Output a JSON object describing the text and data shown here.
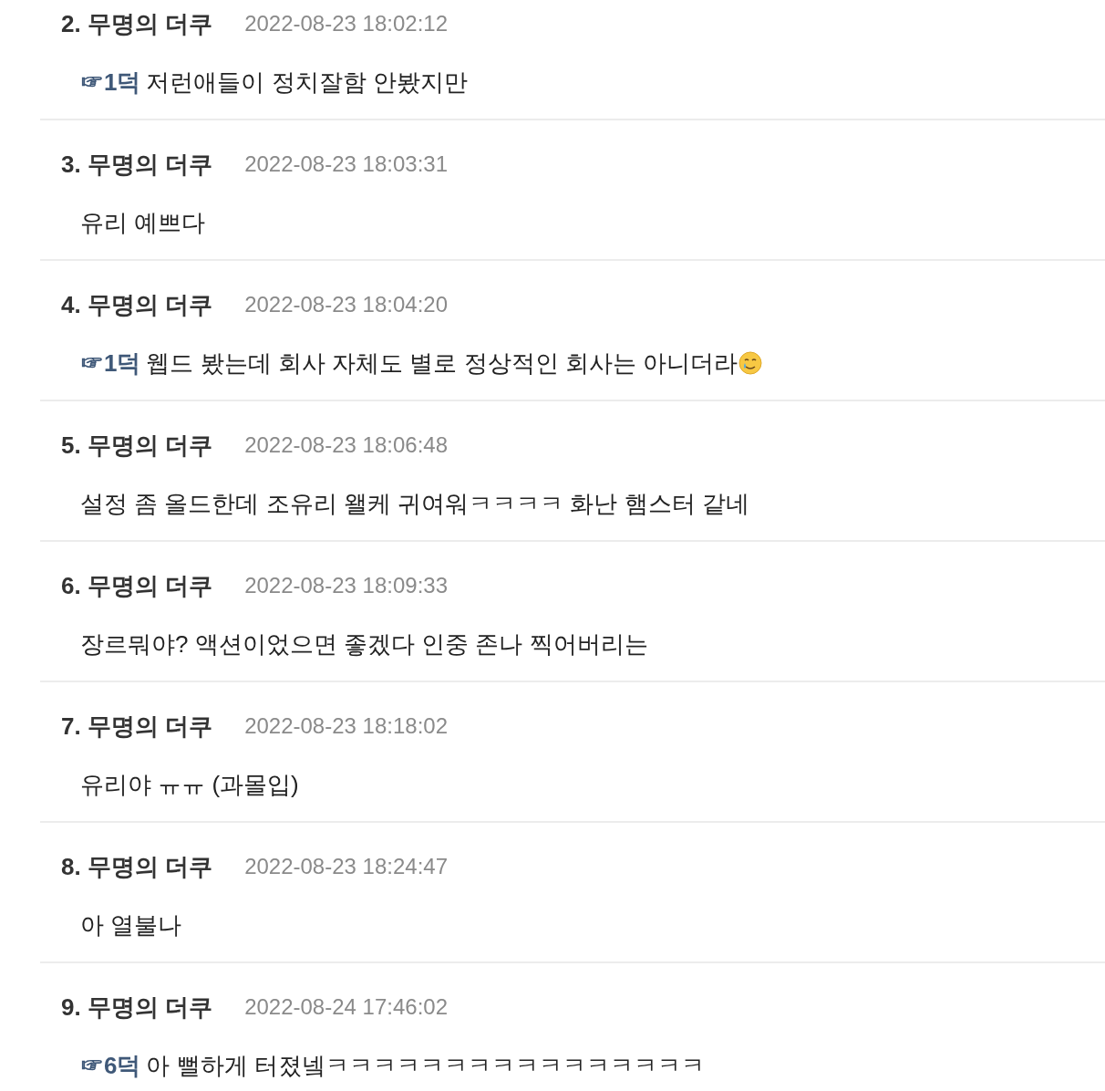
{
  "comments": [
    {
      "kind": "plain",
      "header": "2. 무명의 더쿠",
      "time": "2022-08-23 18:02:12",
      "reply_to": "☞1덕",
      "text": "저런애들이 정치잘함 안봤지만"
    },
    {
      "kind": "plain",
      "header": "3. 무명의 더쿠",
      "time": "2022-08-23 18:03:31",
      "text": "유리 예쁘다"
    },
    {
      "kind": "emoji",
      "header": "4. 무명의 더쿠",
      "time": "2022-08-23 18:04:20",
      "reply_to": "☞1덕",
      "text": "웹드 봤는데 회사 자체도 별로 정상적인 회사는 아니더라"
    },
    {
      "kind": "plain",
      "header": "5. 무명의 더쿠",
      "time": "2022-08-23 18:06:48",
      "text": "설정 좀 올드한데 조유리 왤케 귀여워ㅋㅋㅋㅋ 화난 햄스터 같네"
    },
    {
      "kind": "plain",
      "header": "6. 무명의 더쿠",
      "time": "2022-08-23 18:09:33",
      "text": "장르뭐야? 액션이었으면 좋겠다 인중 존나 찍어버리는"
    },
    {
      "kind": "plain",
      "header": "7. 무명의 더쿠",
      "time": "2022-08-23 18:18:02",
      "text": "유리야 ㅠㅠ (과몰입)"
    },
    {
      "kind": "plain",
      "header": "8. 무명의 더쿠",
      "time": "2022-08-23 18:24:47",
      "text": "아 열불나"
    },
    {
      "kind": "plain",
      "header": "9. 무명의 더쿠",
      "time": "2022-08-24 17:46:02",
      "reply_to": "☞6덕",
      "text": "아 뻘하게 터졌넼ㅋㅋㅋㅋㅋㅋㅋㅋㅋㅋㅋㅋㅋㅋㅋㅋ"
    }
  ]
}
